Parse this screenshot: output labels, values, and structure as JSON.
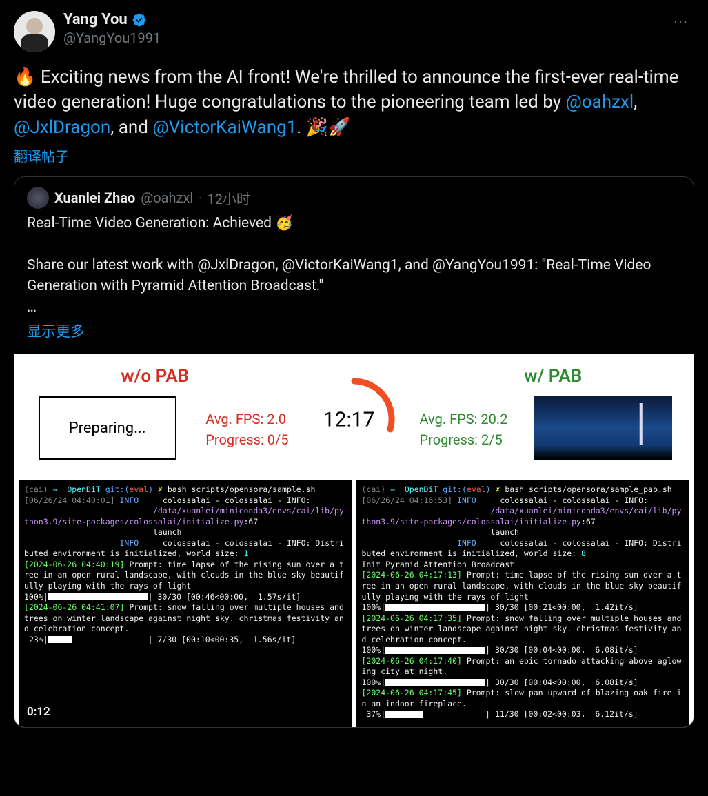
{
  "author": {
    "name": "Yang You",
    "handle": "@YangYou1991",
    "verified": true
  },
  "more_label": "···",
  "body": {
    "pre": "🔥 Exciting news from the AI front! We're thrilled to announce the first-ever real-time video generation! Huge congratulations to the pioneering team led by ",
    "m1": "@oahzxl",
    "sep1": ", ",
    "m2": "@JxlDragon",
    "sep2": ", and ",
    "m3": "@VictorKaiWang1",
    "post": ". 🎉🚀"
  },
  "translate": "翻译帖子",
  "quoted": {
    "name": "Xuanlei Zhao",
    "handle": "@oahzxl",
    "time": "12小时",
    "line1": "Real-Time Video Generation: Achieved 🥳",
    "line2": "Share our latest work with @JxlDragon, @VictorKaiWang1, and @YangYou1991: \"Real-Time Video Generation with Pyramid Attention Broadcast.\"",
    "line3": "…",
    "show_more": "显示更多"
  },
  "media": {
    "duration_badge": "0:12",
    "left_title": "w/o PAB",
    "right_title": "w/ PAB",
    "timer": "12:17",
    "preparing": "Preparing...",
    "left_fps": "Avg. FPS: 2.0",
    "left_prog": "Progress: 0/5",
    "right_fps": "Avg. FPS: 20.2",
    "right_prog": "Progress: 2/5"
  },
  "term_left": {
    "prompt_env": "(cai)",
    "arrow": "→",
    "repo": "OpenDiT",
    "git": "git:(",
    "branch": "eval",
    "git2": ")",
    "x": "✗",
    "cmd": "bash ",
    "script": "scripts/opensora/sample.sh",
    "ts1": "[06/26/24 04:40:01]",
    "info": "INFO",
    "l1": "colossalai - colossalai - INFO:",
    "l2": "/data/xuanlei/miniconda3/envs/cai/lib/python3.9/site-packages/colossalai/initialize.py",
    "l2b": ":67",
    "l3": "launch",
    "l4": "colossalai - colossalai - INFO: Distributed environment is initialized, world size: ",
    "ws": "1",
    "ts2": "[2024-06-26 04:40:19]",
    "p1": " Prompt: time lapse of the rising sun over a tree in an open rural landscape, with clouds in the blue sky beautifully playing with the rays of light",
    "pr1": "100%|",
    "pr1b": "| 30/30 [00:46<00:00,  1.57s/it]",
    "ts3": "[2024-06-26 04:41:07]",
    "p2": " Prompt: snow falling over multiple houses and trees on winter landscape against night sky. christmas festivity and celebration concept.",
    "pr2": " 23%|",
    "pr2b": "| 7/30 [00:10<00:35,  1.56s/it]"
  },
  "term_right": {
    "prompt_env": "(cai)",
    "arrow": "→",
    "repo": "OpenDiT",
    "git": "git:(",
    "branch": "eval",
    "git2": ")",
    "x": "✗",
    "cmd": "bash ",
    "script": "scripts/opensora/sample_pab.sh",
    "ts1": "[06/26/24 04:16:53]",
    "info": "INFO",
    "l1": "colossalai - colossalai - INFO:",
    "l2": "/data/xuanlei/miniconda3/envs/cai/lib/python3.9/site-packages/colossalai/initialize.py",
    "l2b": ":67",
    "l3": "launch",
    "l4": "colossalai - colossalai - INFO: Distributed environment is initialized, world size: ",
    "ws": "8",
    "init": "Init Pyramid Attention Broadcast",
    "ts2": "[2024-06-26 04:17:13]",
    "p1": " Prompt: time lapse of the rising sun over a tree in an open rural landscape, with clouds in the blue sky beautifully playing with the rays of light",
    "pr1": "100%|",
    "pr1b": "| 30/30 [00:21<00:00,  1.42it/s]",
    "ts3": "[2024-06-26 04:17:35]",
    "p2": " Prompt: snow falling over multiple houses and trees on winter landscape against night sky. christmas festivity and celebration concept.",
    "pr2": "100%|",
    "pr2b": "| 30/30 [00:04<00:00,  6.08it/s]",
    "ts4": "[2024-06-26 04:17:40]",
    "p3": " Prompt: an epic tornado attacking above aglowing city at night.",
    "pr3": "100%|",
    "pr3b": "| 30/30 [00:04<00:00,  6.08it/s]",
    "ts5": "[2024-06-26 04:17:45]",
    "p4": " Prompt: slow pan upward of blazing oak fire in an indoor fireplace.",
    "pr4": " 37%|",
    "pr4b": "| 11/30 [00:02<00:03,  6.12it/s]"
  }
}
